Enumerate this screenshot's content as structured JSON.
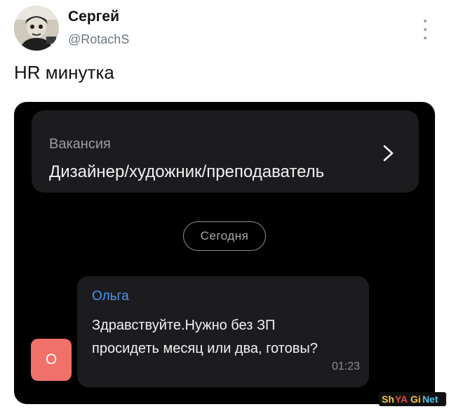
{
  "post": {
    "author_name": "Сергей",
    "author_handle": "@RotachS",
    "text": "HR минутка"
  },
  "chat": {
    "vacancy_label": "Вакансия",
    "vacancy_title": "Дизайнер/художник/преподаватель",
    "date_divider": "Сегодня",
    "message": {
      "sender_initial": "О",
      "sender_name": "Ольга",
      "text_line1": "Здравствуйте.Нужно без ЗП",
      "text_line2": "просидеть месяц или два, готовы?",
      "time": "01:23"
    }
  },
  "watermark": {
    "text": "ShYAGiNet"
  },
  "icons": {
    "more": "more-vertical-icon",
    "chevron": "chevron-right-icon"
  },
  "colors": {
    "sender_name": "#4c95e8",
    "sender_avatar": "#f0706a",
    "chat_background": "#000000",
    "bubble": "#1c1c1e"
  }
}
